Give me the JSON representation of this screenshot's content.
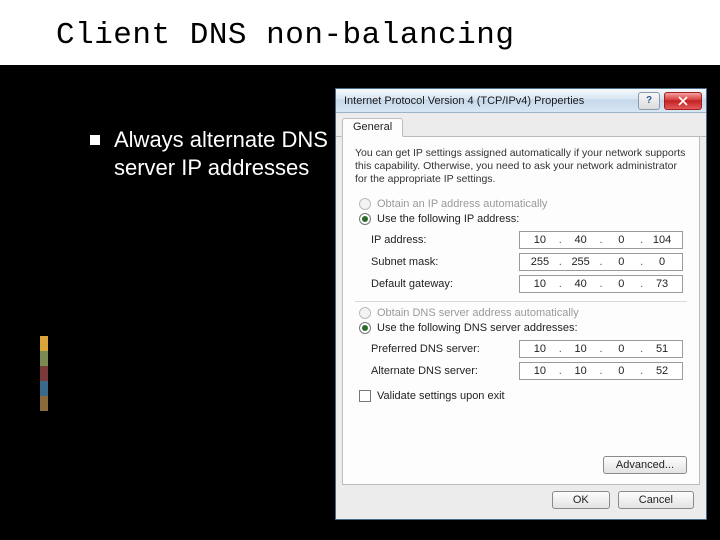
{
  "slide": {
    "title": "Client DNS non-balancing",
    "bullet1": "Always alternate DNS server IP addresses"
  },
  "accent_colors": [
    "#d9a43a",
    "#7a8a50",
    "#7a3a3a",
    "#3a6a8a",
    "#8a6a3a"
  ],
  "dialog": {
    "title": "Internet Protocol Version 4 (TCP/IPv4) Properties",
    "tab": "General",
    "intro": "You can get IP settings assigned automatically if your network supports this capability. Otherwise, you need to ask your network administrator for the appropriate IP settings.",
    "radio_auto_ip": "Obtain an IP address automatically",
    "radio_static_ip": "Use the following IP address:",
    "ip_label": "IP address:",
    "ip_value": [
      "10",
      "40",
      "0",
      "104"
    ],
    "mask_label": "Subnet mask:",
    "mask_value": [
      "255",
      "255",
      "0",
      "0"
    ],
    "gw_label": "Default gateway:",
    "gw_value": [
      "10",
      "40",
      "0",
      "73"
    ],
    "radio_auto_dns": "Obtain DNS server address automatically",
    "radio_static_dns": "Use the following DNS server addresses:",
    "pdns_label": "Preferred DNS server:",
    "pdns_value": [
      "10",
      "10",
      "0",
      "51"
    ],
    "adns_label": "Alternate DNS server:",
    "adns_value": [
      "10",
      "10",
      "0",
      "52"
    ],
    "validate": "Validate settings upon exit",
    "advanced": "Advanced...",
    "ok": "OK",
    "cancel": "Cancel"
  }
}
